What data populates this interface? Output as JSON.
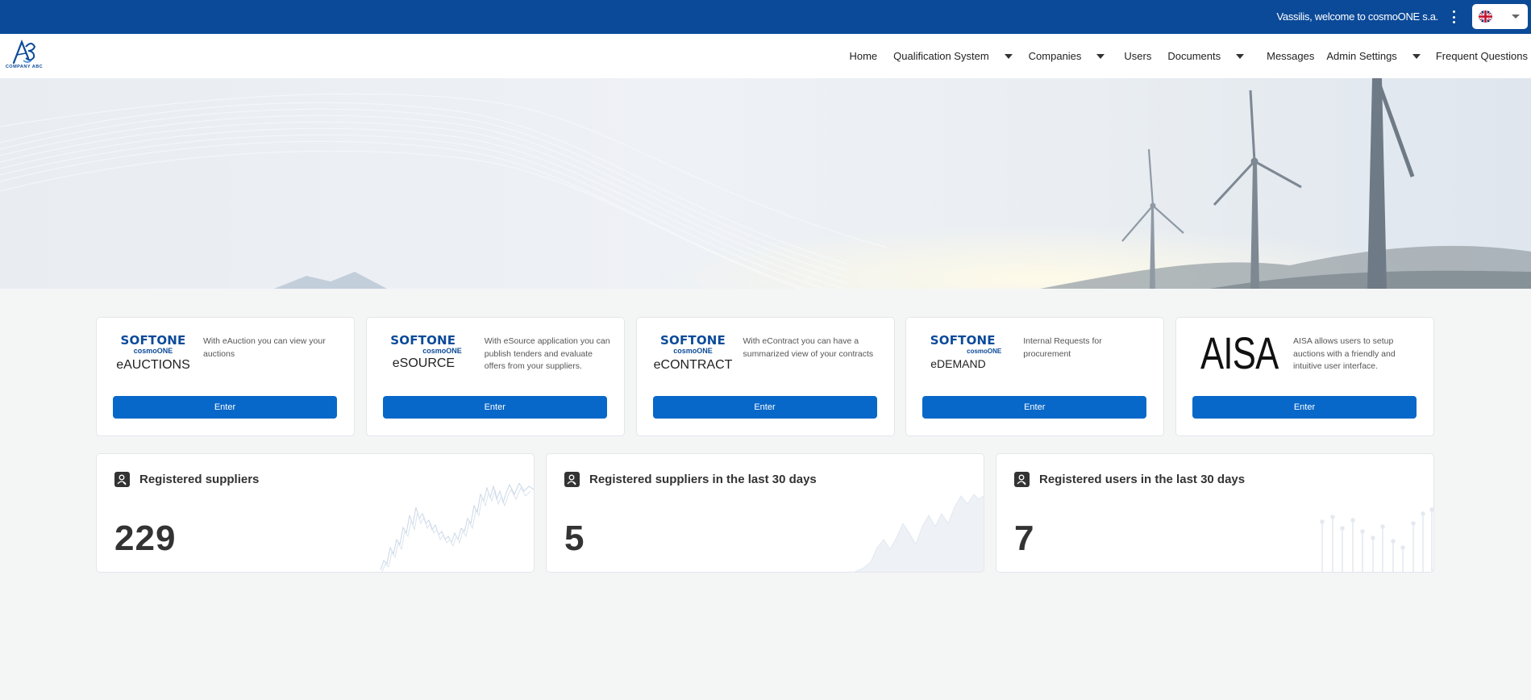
{
  "header": {
    "welcome": "Vassilis, welcome to cosmoONE s.a.",
    "language": "English"
  },
  "logo": {
    "text": "COMPANY ABC"
  },
  "nav": {
    "items": [
      {
        "label": "Home",
        "dropdown": false
      },
      {
        "label": "Qualification System",
        "dropdown": true
      },
      {
        "label": "Companies",
        "dropdown": true
      },
      {
        "label": "Users",
        "dropdown": false
      },
      {
        "label": "Documents",
        "dropdown": true
      },
      {
        "label": "Messages",
        "dropdown": false
      },
      {
        "label": "Admin Settings",
        "dropdown": true
      },
      {
        "label": "Frequent Questions",
        "dropdown": false
      }
    ]
  },
  "apps": [
    {
      "brand": "SOFTONE",
      "sub": "cosmoONE",
      "product": "eAUCTIONS",
      "desc": "With eAuction you can view your auctions",
      "button": "Enter"
    },
    {
      "brand": "SOFTONE",
      "sub": "cosmoONE",
      "product": "eSOURCE",
      "desc": "With eSource application you can publish tenders and evaluate offers from your suppliers.",
      "button": "Enter"
    },
    {
      "brand": "SOFTONE",
      "sub": "cosmoONE",
      "product": "eCONTRACT",
      "desc": "With eContract you can have a summarized view of your contracts",
      "button": "Enter"
    },
    {
      "brand": "SOFTONE",
      "sub": "cosmoONE",
      "product": "eDEMAND",
      "desc": "Internal Requests for procurement",
      "button": "Enter"
    },
    {
      "brand": "AISA",
      "desc": "AISA allows users to setup auctions with a friendly and intuitive user interface.",
      "button": "Enter"
    }
  ],
  "stats": [
    {
      "title": "Registered suppliers",
      "value": "229",
      "icon": "user-icon"
    },
    {
      "title": "Registered suppliers in the last 30 days",
      "value": "5",
      "icon": "user-icon"
    },
    {
      "title": "Registered users in the last 30 days",
      "value": "7",
      "icon": "user-icon"
    }
  ],
  "colors": {
    "topbar": "#0b4a99",
    "button": "#0868c9",
    "background": "#f4f6f6"
  }
}
